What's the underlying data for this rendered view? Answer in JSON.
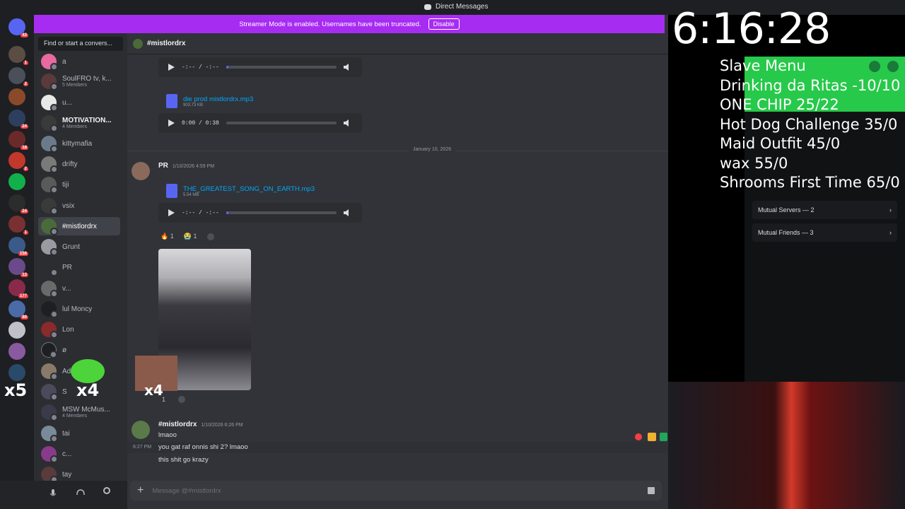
{
  "window_title": "Direct Messages",
  "banner": {
    "text": "Streamer Mode is enabled. Usernames have been truncated.",
    "button": "Disable"
  },
  "rail_badges": [
    "43",
    "1",
    "2",
    "24",
    "18",
    "2",
    "1",
    "24",
    "1",
    "156",
    "13",
    "177",
    "89",
    "1"
  ],
  "dm_search_placeholder": "Find or start a convers...",
  "dm_list": [
    {
      "name": "a",
      "sub": ""
    },
    {
      "name": "SoulFRO tv, k...",
      "sub": "5 Members"
    },
    {
      "name": "u...",
      "sub": ""
    },
    {
      "name": "MOTIVATION...",
      "sub": "4 Members"
    },
    {
      "name": "kittymafia",
      "sub": ""
    },
    {
      "name": "drifty",
      "sub": ""
    },
    {
      "name": "tiji",
      "sub": ""
    },
    {
      "name": "vsix",
      "sub": ""
    },
    {
      "name": "#mistlordrx",
      "sub": ""
    },
    {
      "name": "Grunt",
      "sub": ""
    },
    {
      "name": "PR",
      "sub": ""
    },
    {
      "name": "v...",
      "sub": ""
    },
    {
      "name": "lul Moncy",
      "sub": ""
    },
    {
      "name": "Lon",
      "sub": ""
    },
    {
      "name": "ø",
      "sub": ""
    },
    {
      "name": "Ad",
      "sub": ""
    },
    {
      "name": "S",
      "sub": ""
    },
    {
      "name": "MSW McMus...",
      "sub": "4 Members"
    },
    {
      "name": "tai",
      "sub": ""
    },
    {
      "name": "c...",
      "sub": ""
    },
    {
      "name": "tay",
      "sub": ""
    }
  ],
  "chat_header": "#mistlordrx",
  "audio1": {
    "time": "-:-- / -:--"
  },
  "file2": {
    "name": "die prod mistlordrx.mp3",
    "size": "903.73 KB"
  },
  "audio2": {
    "time": "0:00 / 0:38"
  },
  "date_divider": "January 10, 2026",
  "msg_pr": {
    "author": "PR",
    "time": "1/10/2026 4:59 PM"
  },
  "file3": {
    "name": "THE_GREATEST_SONG_ON_EARTH.mp3",
    "size": "5.54 MB"
  },
  "audio3": {
    "time": "-:-- / -:--"
  },
  "reactions1": [
    {
      "emoji": "🔥",
      "count": "1"
    },
    {
      "emoji": "😭",
      "count": "1"
    }
  ],
  "reactions2": [
    {
      "emoji": "",
      "count": "1"
    }
  ],
  "msg_mist": {
    "author": "#mistlordrx",
    "time": "1/10/2026 6:26 PM",
    "lines": [
      "lmaoo",
      "you gat raf onnis shi 2? lmaoo",
      "this shit go krazy"
    ],
    "side_time": "6:27 PM"
  },
  "composer_placeholder": "Message @#mistlordrx",
  "clock": "6:16:28",
  "menu_lines": [
    "Slave Menu",
    "Drinking da Ritas -10/10",
    "ONE CHIP 25/22",
    "Hot Dog Challenge  35/0",
    "Maid Outfit 45/0",
    "wax 55/0",
    "Shrooms First Time 65/0"
  ],
  "profile_rows": [
    "Mutual Servers — 2",
    "Mutual Friends — 3"
  ],
  "overlay_x5": "x5",
  "overlay_x4": "x4",
  "colors": {
    "accent": "#5865f2",
    "banner": "#a72cf2",
    "green": "#27c94a"
  }
}
